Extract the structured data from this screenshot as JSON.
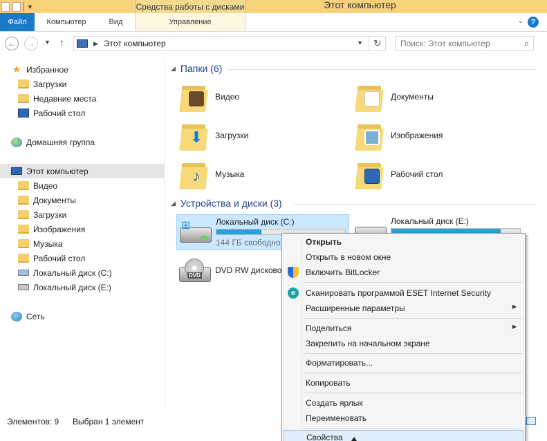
{
  "window": {
    "title": "Этот компьютер",
    "context_tab_group": "Средства работы с дисками",
    "tabs": [
      "Файл",
      "Компьютер",
      "Вид",
      "Управление"
    ]
  },
  "address": {
    "crumb": "Этот компьютер",
    "search_placeholder": "Поиск: Этот компьютер"
  },
  "nav": {
    "favorites": {
      "label": "Избранное",
      "items": [
        "Загрузки",
        "Недавние места",
        "Рабочий стол"
      ]
    },
    "homegroup": "Домашняя группа",
    "this_pc": {
      "label": "Этот компьютер",
      "items": [
        "Видео",
        "Документы",
        "Загрузки",
        "Изображения",
        "Музыка",
        "Рабочий стол",
        "Локальный диск (C:)",
        "Локальный диск (E:)"
      ]
    },
    "network": "Сеть"
  },
  "folders": {
    "heading": "Папки (6)",
    "items": [
      "Видео",
      "Документы",
      "Загрузки",
      "Изображения",
      "Музыка",
      "Рабочий стол"
    ]
  },
  "devices": {
    "heading": "Устройства и диски (3)",
    "drive_c": {
      "name": "Локальный диск (C:)",
      "free": "144 ГБ свободно",
      "used_fraction": 0.35
    },
    "drive_e": {
      "name": "Локальный диск (E:)",
      "used_fraction": 0.85
    },
    "dvd": {
      "name": "DVD RW дисковод",
      "label": "DVD"
    }
  },
  "status": {
    "items_count": "Элементов: 9",
    "selected": "Выбран 1 элемент"
  },
  "context_menu": {
    "items": [
      "Открыть",
      "Открыть в новом окне",
      "Включить BitLocker",
      "Сканировать программой ESET Internet Security",
      "Расширенные параметры",
      "Поделиться",
      "Закрепить на начальном экране",
      "Форматировать...",
      "Копировать",
      "Создать ярлык",
      "Переименовать",
      "Свойства"
    ]
  },
  "colors": {
    "accent": "#1979ca",
    "title_bar": "#f7d27a",
    "selection": "#cce8ff",
    "group_heading": "#1e3f8c"
  }
}
